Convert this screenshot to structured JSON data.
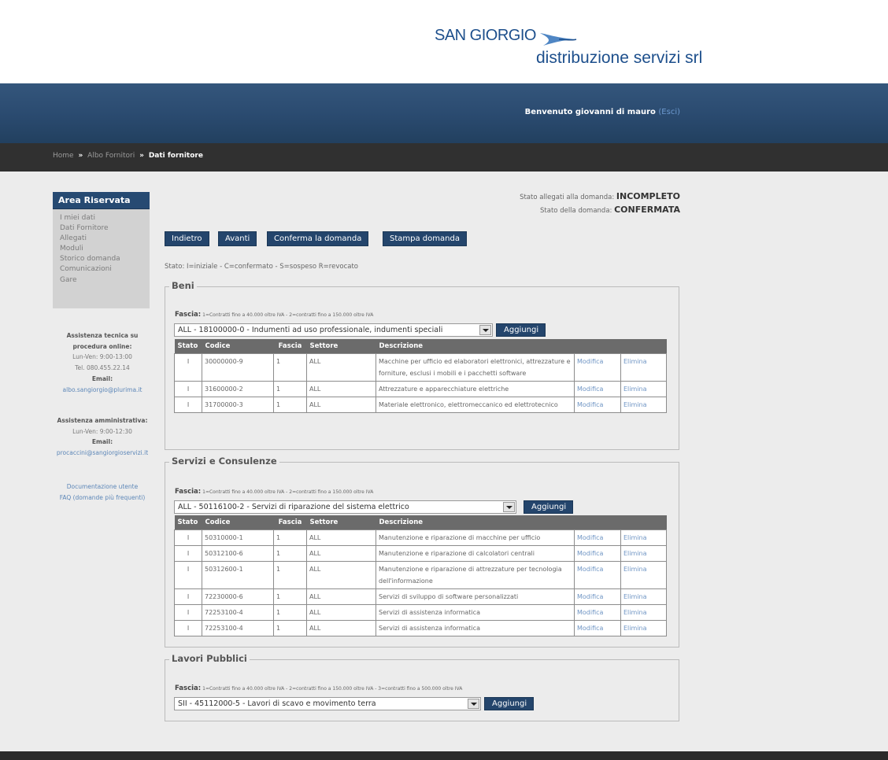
{
  "brand": {
    "name": "SAN GIORGIO",
    "tagline": "distribuzione servizi srl"
  },
  "header": {
    "welcome": "Benvenuto giovanni di mauro",
    "logout": "(Esci)"
  },
  "breadcrumb": {
    "home": "Home",
    "sep": "»",
    "albo": "Albo Fornitori",
    "current": "Dati fornitore"
  },
  "sidebar": {
    "title": "Area Riservata",
    "items": [
      "I miei dati",
      "Dati Fornitore",
      "Allegati",
      "Moduli",
      "Storico domanda",
      "Comunicazioni",
      "Gare"
    ],
    "tech": {
      "title": "Assistenza tecnica su",
      "title2": "procedura online:",
      "hours": "Lun-Ven: 9:00-13:00",
      "phone": "Tel. 080.455.22.14",
      "email_label": "Email:",
      "email": "albo.sangiorgio@plurima.it"
    },
    "admin": {
      "title": "Assistenza amministrativa:",
      "hours": "Lun-Ven: 9:00-12:30",
      "email_label": "Email:",
      "email": "procaccini@sangiorgioservizi.it"
    },
    "doc_link": "Documentazione utente",
    "faq_link": "FAQ (domande più frequenti)"
  },
  "status": {
    "allegati_label": "Stato allegati alla domanda:",
    "allegati_value": "INCOMPLETO",
    "domanda_label": "Stato della domanda:",
    "domanda_value": "CONFERMATA"
  },
  "toolbar": {
    "back": "Indietro",
    "next": "Avanti",
    "confirm": "Conferma la domanda",
    "print": "Stampa domanda"
  },
  "legend": "Stato: I=iniziale - C=confermato - S=sospeso R=revocato",
  "columns": {
    "stato": "Stato",
    "codice": "Codice",
    "fascia": "Fascia",
    "settore": "Settore",
    "descrizione": "Descrizione"
  },
  "actions": {
    "edit": "Modifica",
    "delete": "Elimina",
    "add": "Aggiungi"
  },
  "fascia_label": "Fascia:",
  "sections": {
    "beni": {
      "title": "Beni",
      "fascia_note": "1=Contratti fino a 40.000 oltre IVA - 2=contratti fino a 150.000 oltre IVA",
      "selected": "ALL - 18100000-0 - Indumenti ad uso professionale, indumenti speciali",
      "rows": [
        {
          "stato": "I",
          "codice": "30000000-9",
          "fascia": "1",
          "settore": "ALL",
          "descrizione": "Macchine per ufficio ed elaboratori elettronici, attrezzature e forniture, esclusi i mobili e i pacchetti software"
        },
        {
          "stato": "I",
          "codice": "31600000-2",
          "fascia": "1",
          "settore": "ALL",
          "descrizione": "Attrezzature e apparecchiature elettriche"
        },
        {
          "stato": "I",
          "codice": "31700000-3",
          "fascia": "1",
          "settore": "ALL",
          "descrizione": "Materiale elettronico, elettromeccanico ed elettrotecnico"
        }
      ]
    },
    "servizi": {
      "title": "Servizi e Consulenze",
      "fascia_note": "1=Contratti fino a 40.000 oltre IVA - 2=contratti fino a 150.000 oltre IVA",
      "selected": "ALL - 50116100-2 - Servizi di riparazione del sistema elettrico",
      "rows": [
        {
          "stato": "I",
          "codice": "50310000-1",
          "fascia": "1",
          "settore": "ALL",
          "descrizione": "Manutenzione e riparazione di macchine per ufficio"
        },
        {
          "stato": "I",
          "codice": "50312100-6",
          "fascia": "1",
          "settore": "ALL",
          "descrizione": "Manutenzione e riparazione di calcolatori centrali"
        },
        {
          "stato": "I",
          "codice": "50312600-1",
          "fascia": "1",
          "settore": "ALL",
          "descrizione": "Manutenzione e riparazione di attrezzature per tecnologia dell'informazione"
        },
        {
          "stato": "I",
          "codice": "72230000-6",
          "fascia": "1",
          "settore": "ALL",
          "descrizione": "Servizi di sviluppo di software personalizzati"
        },
        {
          "stato": "I",
          "codice": "72253100-4",
          "fascia": "1",
          "settore": "ALL",
          "descrizione": "Servizi di assistenza informatica"
        },
        {
          "stato": "I",
          "codice": "72253100-4",
          "fascia": "1",
          "settore": "ALL",
          "descrizione": "Servizi di assistenza informatica"
        }
      ]
    },
    "lavori": {
      "title": "Lavori Pubblici",
      "fascia_note": "1=Contratti fino a 40.000 oltre IVA - 2=contratti fino a 150.000 oltre IVA - 3=contratti fino a 500.000 oltre IVA",
      "selected": "SII - 45112000-5 - Lavori di scavo e movimento terra"
    }
  }
}
